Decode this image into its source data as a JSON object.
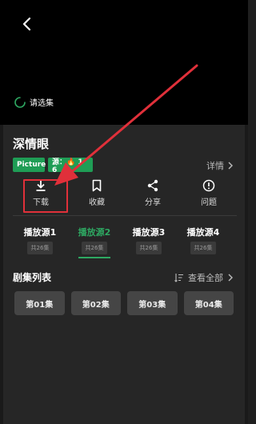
{
  "player": {
    "loading_text": "请选集"
  },
  "show": {
    "title": "深情眼",
    "badge_picture": "Picture",
    "badge_source": "源：🔥 1 6",
    "details_label": "详情"
  },
  "actions": [
    {
      "label": "下载",
      "icon": "download-icon"
    },
    {
      "label": "收藏",
      "icon": "bookmark-icon"
    },
    {
      "label": "分享",
      "icon": "share-icon"
    },
    {
      "label": "问题",
      "icon": "info-icon"
    }
  ],
  "sources": [
    {
      "name": "播放源1",
      "count": "共26集"
    },
    {
      "name": "播放源2",
      "count": "共26集"
    },
    {
      "name": "播放源3",
      "count": "共26集"
    },
    {
      "name": "播放源4",
      "count": "共26集"
    }
  ],
  "episode_list": {
    "title": "剧集列表",
    "view_all_label": "查看全部",
    "episodes": [
      "第01集",
      "第02集",
      "第03集",
      "第04集"
    ]
  },
  "colors": {
    "accent_green": "#2ea862",
    "badge_green": "#1f9d55",
    "annotation_red": "#e0303a"
  }
}
